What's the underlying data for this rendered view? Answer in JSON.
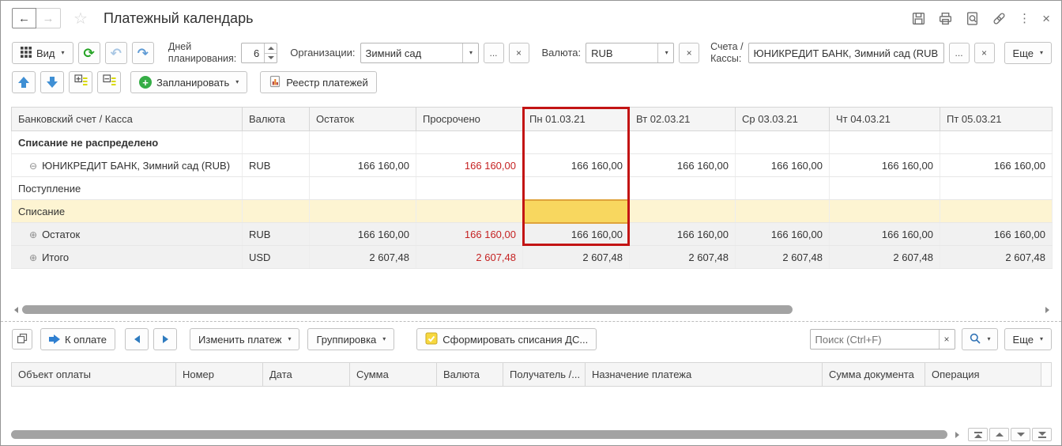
{
  "glyphs": {
    "back": "←",
    "forward": "→",
    "star": "☆",
    "kebab": "⋮",
    "close": "×",
    "caret": "▾",
    "ellipsis": "...",
    "clear": "×",
    "refresh": "⟳",
    "undo": "↶",
    "redo": "↷",
    "collapse": "⊖",
    "expand": "⊕",
    "plus": "+"
  },
  "titlebar": {
    "title": "Платежный календарь"
  },
  "filters": {
    "view": "Вид",
    "days_label_1": "Дней",
    "days_label_2": "планирования:",
    "days_value": "6",
    "org_label": "Организации:",
    "org_value": "Зимний сад",
    "currency_label": "Валюта:",
    "currency_value": "RUB",
    "accounts_label_1": "Счета /",
    "accounts_label_2": "Кассы:",
    "accounts_value": "ЮНИКРЕДИТ БАНК, Зимний сад (RUB",
    "more": "Еще"
  },
  "actions": {
    "plan": "Запланировать",
    "register": "Реестр платежей"
  },
  "calendar": {
    "columns": [
      "Банковский счет / Касса",
      "Валюта",
      "Остаток",
      "Просрочено",
      "Пн 01.03.21",
      "Вт 02.03.21",
      "Ср 03.03.21",
      "Чт 04.03.21",
      "Пт 05.03.21"
    ],
    "rows": [
      {
        "label": "Списание не распределено"
      },
      {
        "expander": "⊖",
        "label": "ЮНИКРЕДИТ БАНК, Зимний сад (RUB)",
        "currency": "RUB",
        "balance": "166 160,00",
        "overdue": "166 160,00",
        "days": [
          "166 160,00",
          "166 160,00",
          "166 160,00",
          "166 160,00",
          "166 160,00"
        ]
      },
      {
        "label": "Поступление"
      },
      {
        "label": "Списание"
      },
      {
        "expander": "⊕",
        "label": "Остаток",
        "currency": "RUB",
        "balance": "166 160,00",
        "overdue": "166 160,00",
        "days": [
          "166 160,00",
          "166 160,00",
          "166 160,00",
          "166 160,00",
          "166 160,00"
        ]
      },
      {
        "expander": "⊕",
        "label": "Итого",
        "currency": "USD",
        "balance": "2 607,48",
        "overdue": "2 607,48",
        "days": [
          "2 607,48",
          "2 607,48",
          "2 607,48",
          "2 607,48",
          "2 607,48"
        ]
      }
    ]
  },
  "payments_toolbar": {
    "pay": "К оплате",
    "edit": "Изменить платеж",
    "group": "Группировка",
    "form_writeoffs": "Сформировать списания ДС...",
    "search_placeholder": "Поиск (Ctrl+F)",
    "more": "Еще"
  },
  "payments": {
    "columns": [
      "Объект оплаты",
      "Номер",
      "Дата",
      "Сумма",
      "Валюта",
      "Получатель /...",
      "Назначение платежа",
      "Сумма документа",
      "Операция"
    ]
  },
  "colors": {
    "highlight_red": "#c31414",
    "overdue_red": "#c52222",
    "selected_cell_yellow": "#f8d75f",
    "row_yellow": "#fdf4d2",
    "accent_blue": "#2f7fd0",
    "accent_green": "#35ad46"
  }
}
